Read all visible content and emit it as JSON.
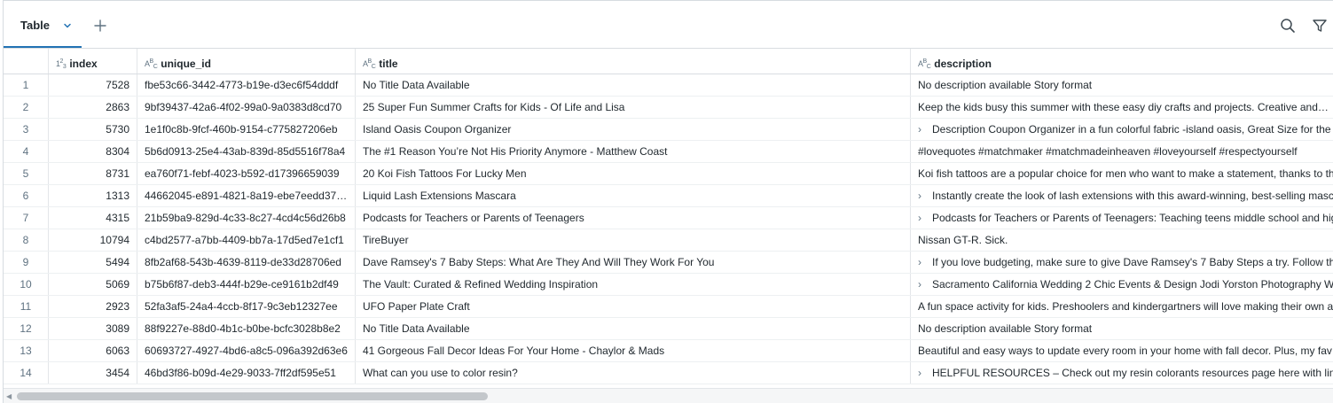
{
  "toolbar": {
    "tab_label": "Table",
    "add_tab_icon": "plus-icon",
    "tab_menu_icon": "chevron-down-icon",
    "search_icon": "search-icon",
    "filter_icon": "filter-icon",
    "accent_color": "#2272b4"
  },
  "table": {
    "columns": [
      {
        "name": "index",
        "type_icon": "1 2 3"
      },
      {
        "name": "unique_id",
        "type_icon": "A B C"
      },
      {
        "name": "title",
        "type_icon": "A B C"
      },
      {
        "name": "description",
        "type_icon": "A B C"
      }
    ],
    "rows": [
      {
        "rn": "1",
        "index": "7528",
        "unique_id": "fbe53c66-3442-4773-b19e-d3ec6f54dddf",
        "title": "No Title Data Available",
        "description": "No description available Story format",
        "expandable": false
      },
      {
        "rn": "2",
        "index": "2863",
        "unique_id": "9bf39437-42a6-4f02-99a0-9a0383d8cd70",
        "title": "25 Super Fun Summer Crafts for Kids - Of Life and Lisa",
        "description": "Keep the kids busy this summer with these easy diy crafts and projects. Creative and…",
        "expandable": false
      },
      {
        "rn": "3",
        "index": "5730",
        "unique_id": "1e1f0c8b-9fcf-460b-9154-c775827206eb",
        "title": "Island Oasis Coupon Organizer",
        "description": "Description Coupon Organizer in a fun colorful fabric -island oasis, Great Size for the",
        "expandable": true
      },
      {
        "rn": "4",
        "index": "8304",
        "unique_id": "5b6d0913-25e4-43ab-839d-85d5516f78a4",
        "title": "The #1 Reason You’re Not His Priority Anymore - Matthew Coast",
        "description": "#lovequotes #matchmaker #matchmadeinheaven #loveyourself #respectyourself",
        "expandable": false
      },
      {
        "rn": "5",
        "index": "8731",
        "unique_id": "ea760f71-febf-4023-b592-d17396659039",
        "title": "20 Koi Fish Tattoos For Lucky Men",
        "description": "Koi fish tattoos are a popular choice for men who want to make a statement, thanks to th",
        "expandable": false
      },
      {
        "rn": "6",
        "index": "1313",
        "unique_id": "44662045-e891-4821-8a19-ebe7eedd37…",
        "title": "Liquid Lash Extensions Mascara",
        "description": "Instantly create the look of lash extensions with this award-winning, best-selling masc",
        "expandable": true
      },
      {
        "rn": "7",
        "index": "4315",
        "unique_id": "21b59ba9-829d-4c33-8c27-4cd4c56d26b8",
        "title": "Podcasts for Teachers or Parents of Teenagers",
        "description": "Podcasts for Teachers or Parents of Teenagers: Teaching teens middle school and hig",
        "expandable": true
      },
      {
        "rn": "8",
        "index": "10794",
        "unique_id": "c4bd2577-a7bb-4409-bb7a-17d5ed7e1cf1",
        "title": "TireBuyer",
        "description": "Nissan GT-R. Sick.",
        "expandable": false
      },
      {
        "rn": "9",
        "index": "5494",
        "unique_id": "8fb2af68-543b-4639-8119-de33d28706ed",
        "title": "Dave Ramsey's 7 Baby Steps: What Are They And Will They Work For You",
        "description": "If you love budgeting, make sure to give Dave Ramsey's 7 Baby Steps a try. Follow th",
        "expandable": true
      },
      {
        "rn": "10",
        "index": "5069",
        "unique_id": "b75b6f87-deb3-444f-b29e-ce9161b2df49",
        "title": "The Vault: Curated & Refined Wedding Inspiration",
        "description": "Sacramento California Wedding 2 Chic Events & Design Jodi Yorston Photography W",
        "expandable": true
      },
      {
        "rn": "11",
        "index": "2923",
        "unique_id": "52fa3af5-24a4-4ccb-8f17-9c3eb12327ee",
        "title": "UFO Paper Plate Craft",
        "description": "A fun space activity for kids. Preshoolers and kindergartners will love making their own a",
        "expandable": false
      },
      {
        "rn": "12",
        "index": "3089",
        "unique_id": "88f9227e-88d0-4b1c-b0be-bcfc3028b8e2",
        "title": "No Title Data Available",
        "description": "No description available Story format",
        "expandable": false
      },
      {
        "rn": "13",
        "index": "6063",
        "unique_id": "60693727-4927-4bd6-a8c5-096a392d63e6",
        "title": "41 Gorgeous Fall Decor Ideas For Your Home - Chaylor & Mads",
        "description": "Beautiful and easy ways to update every room in your home with fall decor. Plus, my fav",
        "expandable": false
      },
      {
        "rn": "14",
        "index": "3454",
        "unique_id": "46bd3f86-b09d-4e29-9033-7ff2df595e51",
        "title": "What can you use to color resin?",
        "description": "HELPFUL RESOURCES – Check out my resin colorants resources page here with lin",
        "expandable": true
      }
    ]
  }
}
